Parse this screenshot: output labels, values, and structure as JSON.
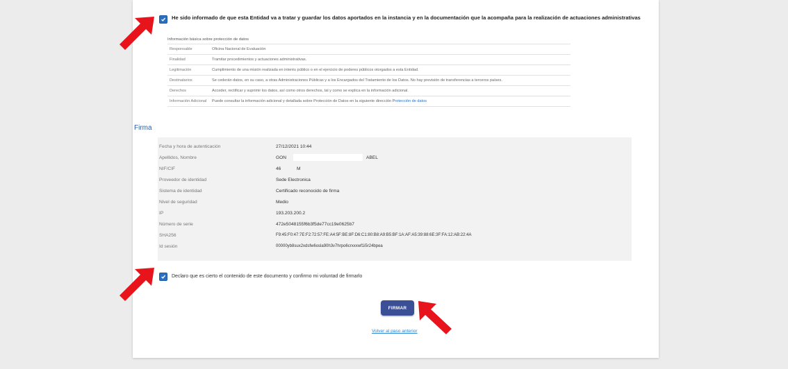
{
  "consent": {
    "checked": true,
    "text": "He sido informado de que esta Entidad va a tratar y guardar los datos aportados en la instancia y en la documentación que la acompaña para la realización de actuaciones administrativas"
  },
  "data_protection": {
    "caption": "Información básica sobre protección de datos",
    "rows": [
      {
        "key": "Responsable",
        "value": "Oficina Nacional de Evaluación"
      },
      {
        "key": "Finalidad",
        "value": "Tramitar procedimientos y actuaciones administrativas."
      },
      {
        "key": "Legitimación",
        "value": "Cumplimiento de una misión realizada en interés público o en el ejercicio de poderes públicos otorgados a esta Entidad."
      },
      {
        "key": "Destinatarios",
        "value": "Se cederán datos, en su caso, a otras Administraciones Públicas y a los Encargados del Tratamiento de los Datos. No hay previsión de transferencias a terceros países."
      },
      {
        "key": "Derechos",
        "value": "Acceder, rectificar y suprimir los datos, así como otros derechos, tal y como se explica en la información adicional."
      },
      {
        "key": "Información Adicional",
        "value": "Puede consultar la información adicional y detallada sobre Protección de Datos en la siguiente dirección",
        "link": "Protección de datos"
      }
    ]
  },
  "firma": {
    "title": "Firma",
    "rows": [
      {
        "key": "Fecha y hora de autenticación",
        "value": "27/12/2021 10:44"
      },
      {
        "key": "Apellidos, Nombre",
        "value": "GON",
        "value2": "ABEL"
      },
      {
        "key": "NIF/CIF",
        "value": "46",
        "value2": "M"
      },
      {
        "key": "Proveedor de identidad",
        "value": "Sede Electronica"
      },
      {
        "key": "Sistema de identidad",
        "value": "Certificado reconocido de firma"
      },
      {
        "key": "Nivel de seguridad",
        "value": "Medio"
      },
      {
        "key": "IP",
        "value": "193.203.200.2"
      },
      {
        "key": "Número de serie",
        "value": "472e5048155f6b3f5de77cc19e0625b7"
      },
      {
        "key": "SHA256",
        "value": "F9:45:F0:47:7E:F2:72:57:FE:A4:5F:BE:8F:D6:C1:80:B8:A9:B5:BF:1A:AF:A5:39:88:6E:3F:FA:12:AB:22:4A"
      },
      {
        "key": "Id sesión",
        "value": "00000yb8sux2xdsfw6osla90h3v7hrpo6crxxxwf1i5r24bpea"
      }
    ]
  },
  "declaration": {
    "checked": true,
    "text": "Declaro que es cierto el contenido de este documento y confirmo mi voluntad de firmarlo"
  },
  "actions": {
    "submit_label": "FIRMAR",
    "back_label": "Volver al paso anterior"
  },
  "colors": {
    "accent": "#2a6fc1",
    "button": "#3b4f96",
    "annotation_arrow": "#e8141b"
  },
  "annotations": [
    "arrow-icon",
    "arrow-icon",
    "arrow-icon"
  ]
}
